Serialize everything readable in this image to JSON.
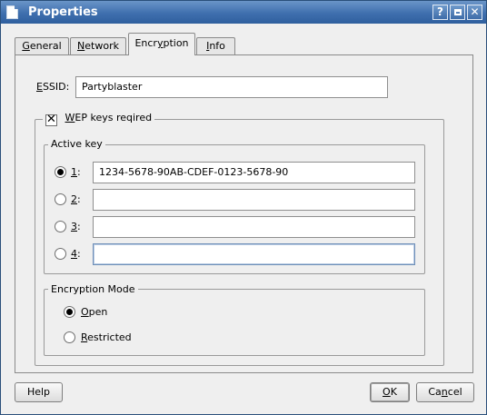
{
  "window": {
    "title": "Properties",
    "help_glyph": "?",
    "close_glyph": "✕"
  },
  "tabs": [
    {
      "label": "General",
      "mnemonic": "G",
      "rest": "eneral"
    },
    {
      "label": "Network",
      "mnemonic": "N",
      "rest": "etwork"
    },
    {
      "label": "Encryption",
      "pre": "Encr",
      "mnemonic": "y",
      "rest": "ption"
    },
    {
      "label": "Info",
      "mnemonic": "I",
      "rest": "nfo"
    }
  ],
  "essid": {
    "label_mnemonic": "E",
    "label_rest": "SSID:",
    "value": "Partyblaster"
  },
  "wep": {
    "checked": true,
    "check_glyph": "✕",
    "label_mnemonic": "W",
    "label_rest": "EP keys reqired"
  },
  "active_key": {
    "title": "Active key",
    "keys": [
      {
        "num": "1",
        "suffix": ":",
        "value": "1234-5678-90AB-CDEF-0123-5678-90",
        "selected": true
      },
      {
        "num": "2",
        "suffix": ":",
        "value": "",
        "selected": false
      },
      {
        "num": "3",
        "suffix": ":",
        "value": "",
        "selected": false
      },
      {
        "num": "4",
        "suffix": ":",
        "value": "",
        "selected": false,
        "focused": true
      }
    ]
  },
  "encryption_mode": {
    "title": "Encryption Mode",
    "options": [
      {
        "pre": "",
        "mnemonic": "O",
        "rest": "pen",
        "label": "Open",
        "selected": true
      },
      {
        "pre": "",
        "mnemonic": "R",
        "rest": "estricted",
        "label": "Restricted",
        "selected": false
      }
    ]
  },
  "buttons": {
    "help": "Help",
    "ok_mnemonic": "O",
    "ok_rest": "K",
    "cancel_pre": "Ca",
    "cancel_mnemonic": "n",
    "cancel_rest": "cel"
  },
  "colors": {
    "titlebar": "#3f6fae",
    "background": "#efefef"
  }
}
